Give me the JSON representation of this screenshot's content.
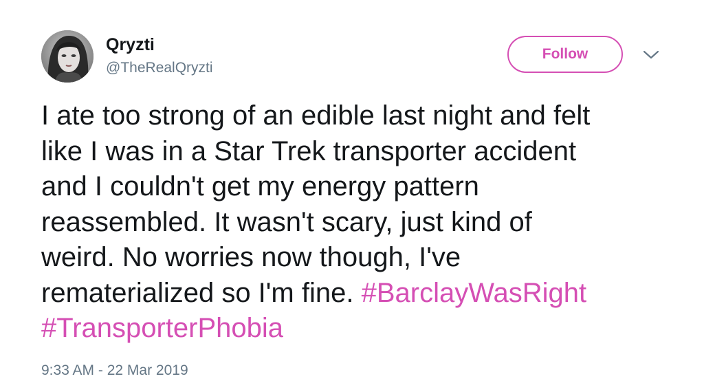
{
  "user": {
    "display_name": "Qryzti",
    "handle": "@TheRealQryzti"
  },
  "actions": {
    "follow_label": "Follow",
    "more_icon": "chevron-down-icon"
  },
  "tweet": {
    "lines": [
      "I ate too strong of an edible last night and felt",
      "like I was in a Star Trek transporter accident",
      "and I couldn't get my energy pattern",
      "reassembled. It wasn't scary, just kind of",
      "weird. No worries now though, I've",
      "rematerialized so I'm fine. "
    ],
    "hashtags": [
      "#BarclayWasRight",
      "#TransporterPhobia"
    ],
    "timestamp": "9:33 AM - 22 Mar 2019"
  },
  "colors": {
    "accent": "#d54fb4",
    "text": "#14171a",
    "secondary_text": "#657786"
  }
}
